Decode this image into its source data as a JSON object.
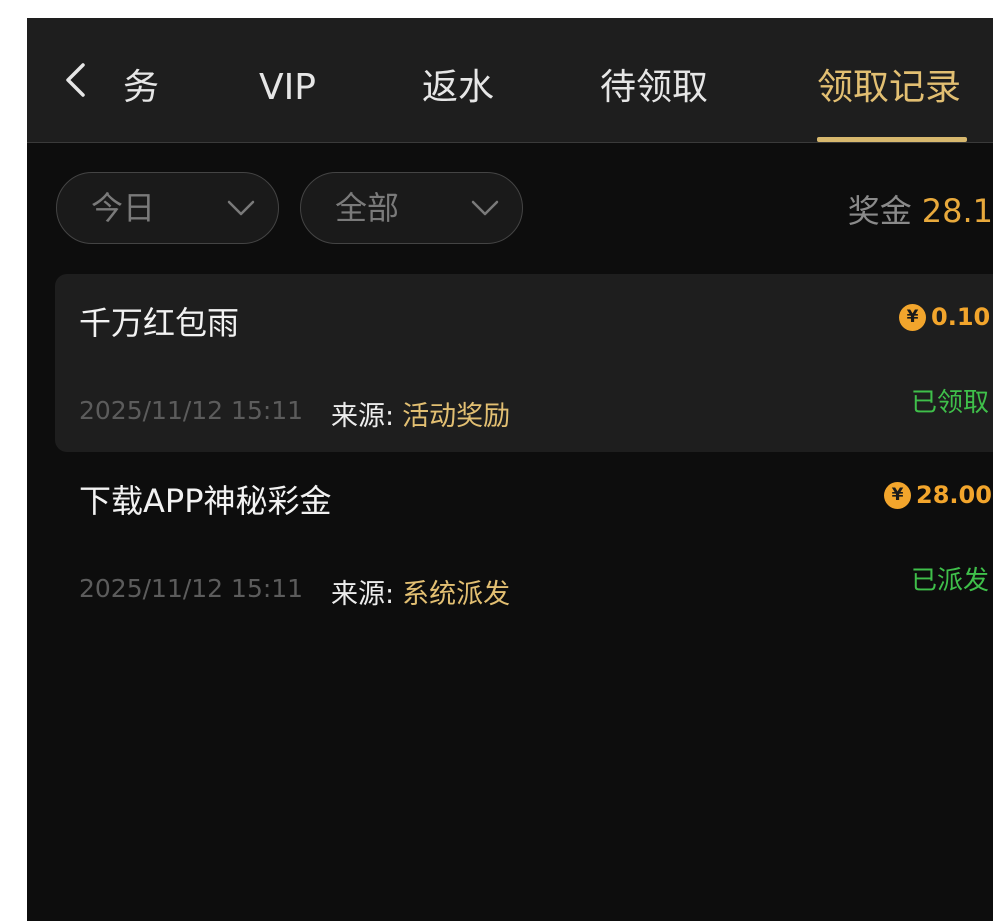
{
  "tabs": [
    {
      "label": "务",
      "active": false
    },
    {
      "label": "VIP",
      "active": false
    },
    {
      "label": "返水",
      "active": false
    },
    {
      "label": "待领取",
      "active": false
    },
    {
      "label": "领取记录",
      "active": true
    }
  ],
  "filters": {
    "date": {
      "selected": "今日",
      "icon": "chevron-down-icon"
    },
    "type": {
      "selected": "全部",
      "icon": "chevron-down-icon"
    }
  },
  "summary": {
    "label": "奖金",
    "value": "28.1"
  },
  "records": [
    {
      "title": "千万红包雨",
      "amount": "0.10",
      "coin_symbol": "¥",
      "time": "2025/11/12 15:11",
      "source_label": "来源:",
      "source": "活动奖励",
      "status": "已领取"
    },
    {
      "title": "下载APP神秘彩金",
      "amount": "28.00",
      "coin_symbol": "¥",
      "time": "2025/11/12 15:11",
      "source_label": "来源:",
      "source": "系统派发",
      "status": "已派发"
    }
  ],
  "colors": {
    "accent": "#e2bf72",
    "amount": "#f2a52c",
    "status": "#3fbf4a",
    "background": "#0d0d0d",
    "header": "#1e1e1e"
  }
}
